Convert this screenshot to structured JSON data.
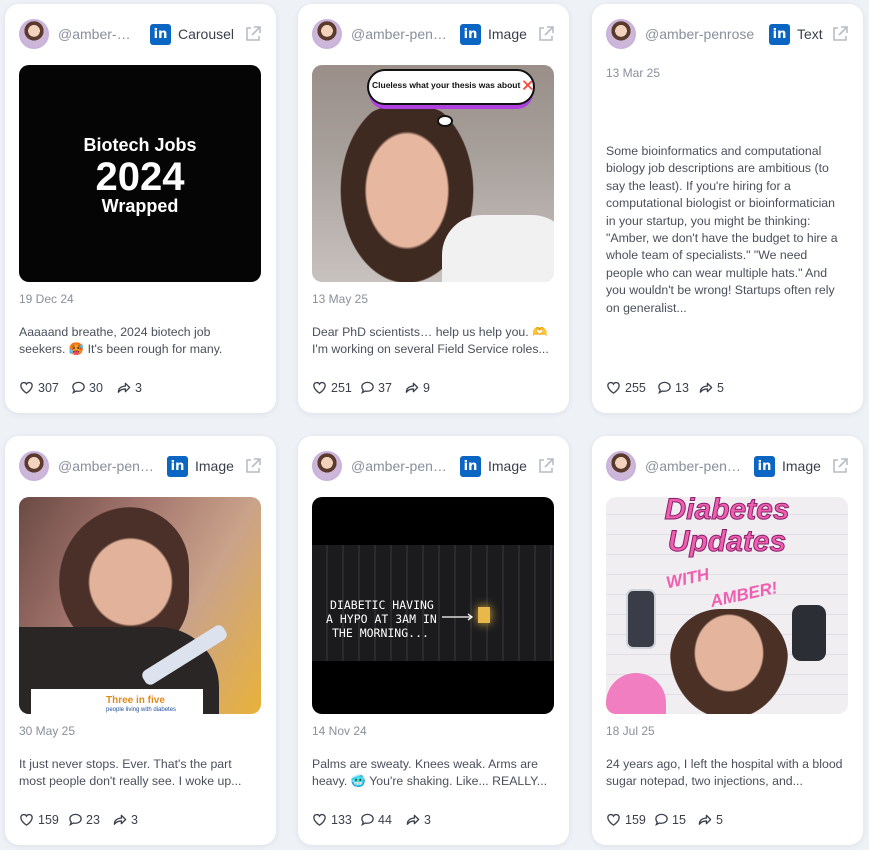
{
  "posts": [
    {
      "handle": "@amber-penrose",
      "type": "Carousel",
      "date": "19 Dec 24",
      "text": "Aaaaand breathe, 2024 biotech job seekers. 🥵 It's been rough for many. Now...",
      "likes": "307",
      "comments": "30",
      "shares": "3",
      "media": {
        "line1": "Biotech Jobs",
        "line2": "2024",
        "line3": "Wrapped"
      }
    },
    {
      "handle": "@amber-penrose",
      "type": "Image",
      "date": "13 May 25",
      "text": "Dear PhD scientists… help us help you. 🫶 I'm working on several Field Service roles...",
      "likes": "251",
      "comments": "37",
      "shares": "9",
      "media": {
        "bubble": "Clueless what your thesis was about ❌"
      }
    },
    {
      "handle": "@amber-penrose",
      "type": "Text",
      "date": "13 Mar 25",
      "text": "Some bioinformatics and computational biology job descriptions are ambitious (to say the least). If you're hiring for a computational biologist or bioinformatician in your startup, you might be thinking: \"Amber, we don't have the budget to hire a whole team of specialists.\" \"We need people who can wear multiple hats.\" And you wouldn't be wrong! Startups often rely on generalist...",
      "likes": "255",
      "comments": "13",
      "shares": "5"
    },
    {
      "handle": "@amber-penrose",
      "type": "Image",
      "date": "30 May 25",
      "text": "It just never stops. Ever. That's the part most people don't really see. I woke up...",
      "likes": "159",
      "comments": "23",
      "shares": "3",
      "media": {
        "headline": "Three in five",
        "sub": "people living with diabetes"
      }
    },
    {
      "handle": "@amber-penrose",
      "type": "Image",
      "date": "14 Nov 24",
      "text": "Palms are sweaty. Knees weak. Arms are heavy. 🥶 You're shaking. Like... REALLY...",
      "likes": "133",
      "comments": "44",
      "shares": "3",
      "media": {
        "line1": "DIABETIC HAVING",
        "line2": "A HYPO AT 3AM IN",
        "line3": "THE MORNING..."
      }
    },
    {
      "handle": "@amber-penrose",
      "type": "Image",
      "date": "18 Jul 25",
      "text": "24 years ago, I left the hospital with a blood sugar notepad, two injections, and...",
      "likes": "159",
      "comments": "15",
      "shares": "5",
      "media": {
        "line1": "Diabetes",
        "line2": "Updates",
        "line3": "WITH",
        "line4": "AMBER!"
      }
    }
  ],
  "colors": {
    "linkedin": "#0a66c2",
    "background": "#eef1f6"
  }
}
